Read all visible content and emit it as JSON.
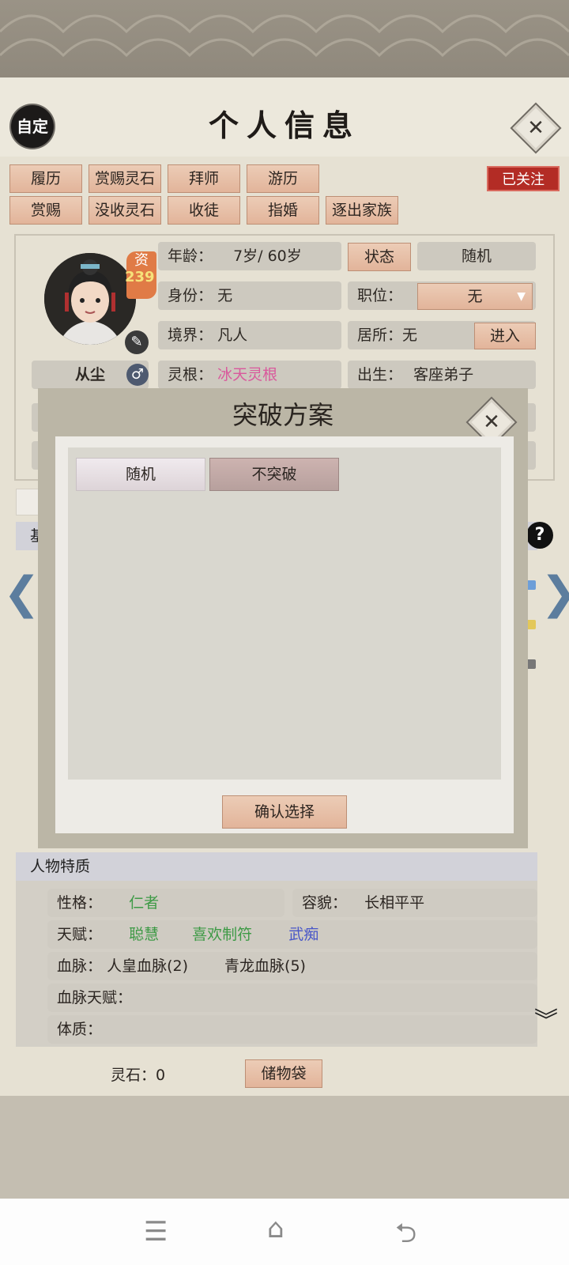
{
  "header": {
    "title": "个人信息",
    "seal_label": "自定"
  },
  "action_buttons": {
    "row1": [
      "履历",
      "赏赐灵石",
      "拜师",
      "游历"
    ],
    "row2": [
      "赏赐",
      "没收灵石",
      "收徒",
      "指婚",
      "逐出家族"
    ],
    "followed_label": "已关注"
  },
  "character": {
    "name": "从尘",
    "aptitude_label": "资",
    "aptitude_value": "239",
    "age_label": "年龄：",
    "age_value": "7岁/ 60岁",
    "status_button": "状态",
    "status_value": "随机",
    "identity_label": "身份：",
    "identity_value": "无",
    "position_label": "职位：",
    "position_value": "无",
    "realm_label": "境界：",
    "realm_value": "凡人",
    "residence_label": "居所：无",
    "enter_button": "进入",
    "root_label": "灵根：",
    "root_value": "冰天灵根",
    "birth_label": "出生：",
    "birth_value": "客座弟子"
  },
  "dialog": {
    "title": "突破方案",
    "options": [
      "随机",
      "不突破"
    ],
    "confirm_label": "确认选择"
  },
  "traits": {
    "section_title": "人物特质",
    "personality_label": "性格：",
    "personality_value": "仁者",
    "appearance_label": "容貌：",
    "appearance_value": "长相平平",
    "talent_label": "天赋：",
    "talents": [
      "聪慧",
      "喜欢制符",
      "武痴"
    ],
    "bloodline_label": "血脉：",
    "bloodlines": [
      "人皇血脉(2)",
      "青龙血脉(5)"
    ],
    "bloodline_talent_label": "血脉天赋：",
    "physique_label": "体质："
  },
  "footer": {
    "spirit_stone": "灵石：0",
    "storage_button": "储物袋"
  },
  "partial": {
    "left_section_char": "基",
    "help": "?"
  },
  "colors": {
    "accent_button": "#e2b49a",
    "followed_badge": "#b32c25",
    "root_pink": "#d9599c",
    "trait_green": "#3e9a46",
    "trait_blue": "#4856c8"
  }
}
